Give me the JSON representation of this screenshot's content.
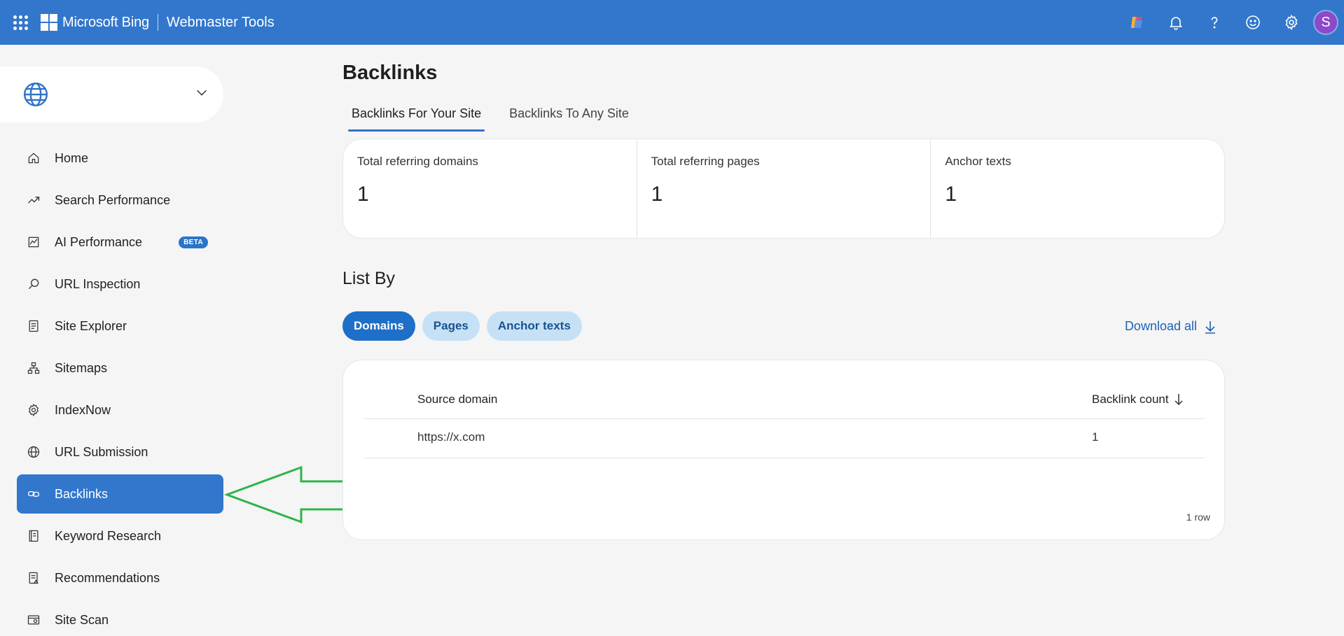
{
  "header": {
    "brand": "Microsoft Bing",
    "product": "Webmaster Tools",
    "avatar_initial": "S",
    "icons": [
      "apps-grid-icon",
      "copilot-icon",
      "bell-icon",
      "help-icon",
      "feedback-smiley-icon",
      "settings-gear-icon"
    ]
  },
  "sidebar": {
    "site_picker_icon": "globe-icon",
    "items": [
      {
        "label": "Home",
        "icon": "home-icon"
      },
      {
        "label": "Search Performance",
        "icon": "trend-icon"
      },
      {
        "label": "AI Performance",
        "icon": "chart-icon",
        "badge": "BETA"
      },
      {
        "label": "URL Inspection",
        "icon": "search-icon"
      },
      {
        "label": "Site Explorer",
        "icon": "document-list-icon"
      },
      {
        "label": "Sitemaps",
        "icon": "sitemap-icon"
      },
      {
        "label": "IndexNow",
        "icon": "gear-icon"
      },
      {
        "label": "URL Submission",
        "icon": "globe-icon"
      },
      {
        "label": "Backlinks",
        "icon": "link-icon",
        "active": true
      },
      {
        "label": "Keyword Research",
        "icon": "book-icon"
      },
      {
        "label": "Recommendations",
        "icon": "clipboard-icon"
      },
      {
        "label": "Site Scan",
        "icon": "scan-icon"
      }
    ]
  },
  "main": {
    "title": "Backlinks",
    "tabs": [
      {
        "label": "Backlinks For Your Site",
        "active": true
      },
      {
        "label": "Backlinks To Any Site",
        "active": false
      }
    ],
    "stats": [
      {
        "label": "Total referring domains",
        "value": "1"
      },
      {
        "label": "Total referring pages",
        "value": "1"
      },
      {
        "label": "Anchor texts",
        "value": "1"
      }
    ],
    "list_by": "List By",
    "pills": [
      {
        "label": "Domains",
        "active": true
      },
      {
        "label": "Pages",
        "active": false
      },
      {
        "label": "Anchor texts",
        "active": false
      }
    ],
    "download_label": "Download all",
    "table": {
      "columns": [
        "Source domain",
        "Backlink count"
      ],
      "rows": [
        {
          "source": "https://x.com",
          "count": "1"
        }
      ],
      "row_count_label": "1 row"
    }
  },
  "colors": {
    "header_bg": "#3277cc",
    "active_nav": "#3277cc",
    "pill_active": "#1e6fc8",
    "pill_inactive": "#c6e1f6",
    "annotation_arrow": "#2db54a"
  }
}
